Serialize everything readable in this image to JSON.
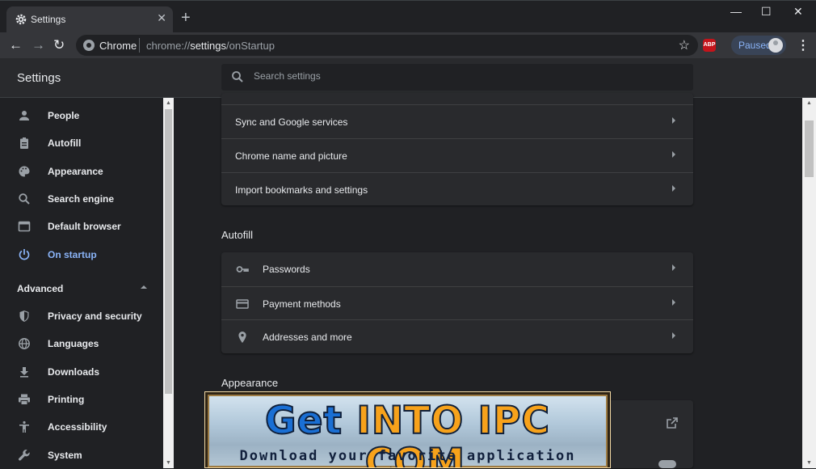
{
  "window": {
    "tab_title": "Settings",
    "tab_close": "✕",
    "new_tab": "+",
    "minimize": "—",
    "maximize": "☐",
    "close": "✕"
  },
  "toolbar": {
    "back": "←",
    "forward": "→",
    "reload": "↻",
    "scheme_label": "Chrome",
    "url_prefix": "chrome://",
    "url_host": "settings",
    "url_path": "/onStartup",
    "bookmark_star": "☆",
    "abp_label": "ABP",
    "profile_label": "Paused",
    "menu": "⋮"
  },
  "header": {
    "title": "Settings",
    "search_placeholder": "Search settings"
  },
  "sidebar": {
    "items": [
      {
        "label": "People",
        "icon": "person-icon"
      },
      {
        "label": "Autofill",
        "icon": "clipboard-icon"
      },
      {
        "label": "Appearance",
        "icon": "palette-icon"
      },
      {
        "label": "Search engine",
        "icon": "search-icon"
      },
      {
        "label": "Default browser",
        "icon": "browser-window-icon"
      },
      {
        "label": "On startup",
        "icon": "power-icon",
        "active": true
      }
    ],
    "advanced_label": "Advanced",
    "advanced_items": [
      {
        "label": "Privacy and security",
        "icon": "shield-icon"
      },
      {
        "label": "Languages",
        "icon": "globe-icon"
      },
      {
        "label": "Downloads",
        "icon": "download-icon"
      },
      {
        "label": "Printing",
        "icon": "printer-icon"
      },
      {
        "label": "Accessibility",
        "icon": "accessibility-icon"
      },
      {
        "label": "System",
        "icon": "wrench-icon"
      }
    ]
  },
  "people_rows": [
    {
      "label": "Sync and Google services"
    },
    {
      "label": "Chrome name and picture"
    },
    {
      "label": "Import bookmarks and settings"
    }
  ],
  "autofill": {
    "title": "Autofill",
    "rows": [
      {
        "label": "Passwords",
        "icon": "key-icon"
      },
      {
        "label": "Payment methods",
        "icon": "credit-card-icon"
      },
      {
        "label": "Addresses and more",
        "icon": "location-pin-icon"
      }
    ]
  },
  "appearance": {
    "title": "Appearance"
  },
  "banner": {
    "logo_part1": "Get ",
    "logo_part2": "INTO",
    "logo_part3": " IPC",
    "logo_part4": " .COM",
    "tagline": "Download your favorite application"
  },
  "colors": {
    "accent": "#8ab4f8",
    "background": "#202124",
    "card": "#292a2d"
  }
}
